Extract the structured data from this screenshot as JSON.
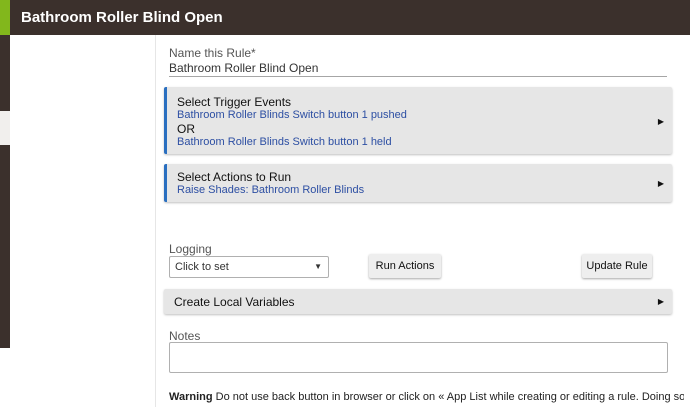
{
  "header": {
    "title": "Bathroom Roller Blind Open"
  },
  "name_field": {
    "label": "Name this Rule*",
    "value": "Bathroom Roller Blind Open"
  },
  "trigger_section": {
    "title": "Select Trigger Events",
    "lines": [
      "Bathroom Roller Blinds Switch button 1 pushed",
      "OR",
      "Bathroom Roller Blinds Switch button 1 held"
    ],
    "arrow": "▶"
  },
  "actions_section": {
    "title": "Select Actions to Run",
    "lines": [
      "Raise Shades: Bathroom Roller Blinds"
    ],
    "arrow": "▶"
  },
  "logging": {
    "label": "Logging",
    "value": "Click to set",
    "caret": "▼"
  },
  "buttons": {
    "run_actions": "Run Actions",
    "update_rule": "Update Rule"
  },
  "local_variables": {
    "title": "Create Local Variables",
    "arrow": "▶"
  },
  "notes": {
    "label": "Notes",
    "value": ""
  },
  "warning": {
    "bold": "Warning",
    "text": " Do not use back button in browser or click on « App List while creating or editing a rule. Doing so"
  },
  "colors": {
    "header_bg": "#3b302c",
    "accent": "#82b71c",
    "link": "#2d4fa3",
    "section_border": "#2a6fc0"
  }
}
